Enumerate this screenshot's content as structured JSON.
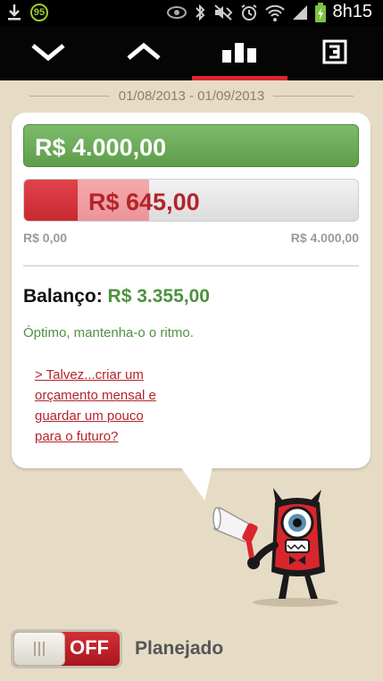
{
  "status_bar": {
    "badge": "95",
    "time": "8h15",
    "icons": [
      "download-icon",
      "notification-count-icon",
      "eye-icon",
      "bluetooth-icon",
      "mute-icon",
      "alarm-icon",
      "wifi-icon",
      "signal-icon",
      "battery-icon"
    ]
  },
  "toolbar": {
    "items": [
      {
        "name": "collapse",
        "icon": "chevron-down-icon",
        "active": false
      },
      {
        "name": "expand",
        "icon": "chevron-up-icon",
        "active": false
      },
      {
        "name": "chart",
        "icon": "bar-chart-icon",
        "active": true
      },
      {
        "name": "export",
        "icon": "exit-icon",
        "active": false
      }
    ]
  },
  "period": {
    "label": "01/08/2013 - 01/09/2013"
  },
  "summary": {
    "income": "R$ 4.000,00",
    "expense": "R$ 645,00",
    "expense_fraction": 0.16,
    "scale_min": "R$ 0,00",
    "scale_max": "R$ 4.000,00",
    "balance_label": "Balanço:",
    "balance_value": "R$ 3.355,00",
    "message": "Óptimo, mantenha-o o ritmo.",
    "suggestion_link": "> Talvez...criar um orçamento mensal e guardar um pouco para o futuro?"
  },
  "colors": {
    "accent": "#d9262d",
    "positive": "#4d9240",
    "negative": "#b5232a",
    "background": "#e6dcc6"
  },
  "mascot": {
    "icon": "monster-megaphone-mascot"
  },
  "planned_toggle": {
    "state": "OFF",
    "label": "Planejado"
  }
}
